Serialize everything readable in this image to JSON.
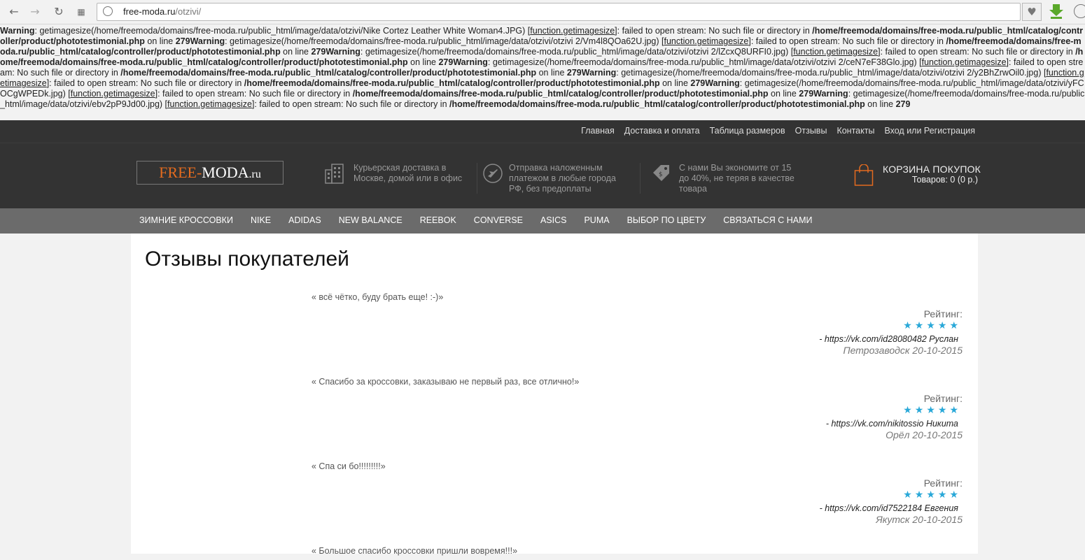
{
  "browser": {
    "url_host": "free-moda.ru",
    "url_path": "/otzivi/"
  },
  "warnings": [
    {
      "bold": "Warning",
      "text": ": getimagesize(/home/freemoda/domains/free-moda.ru/public_html/image/data/otzivi/Nike Cortez Leather White Woman4.JPG) [",
      "func": "function.getimagesize",
      "text2": "]: failed to open stream: No such file or directory in ",
      "path": "/home/freemoda/domains/free-moda.ru/public_html/catalog/controller/product/phototestimonial.php",
      "line_text": " on line ",
      "line": "279"
    },
    {
      "bold": "Warning",
      "text": ": getimagesize(/home/freemoda/domains/free-moda.ru/public_html/image/data/otzivi/otzivi 2/Vm4l8QOa62U.jpg) [",
      "func": "function.getimagesize",
      "text2": "]: failed to open stream: No such file or directory in ",
      "path": "/home/freemoda/domains/free-moda.ru/public_html/catalog/controller/product/phototestimonial.php",
      "line_text": " on line ",
      "line": "279"
    },
    {
      "bold": "Warning",
      "text": ": getimagesize(/home/freemoda/domains/free-moda.ru/public_html/image/data/otzivi/otzivi 2/lZcxQ8URFI0.jpg) [",
      "func": "function.getimagesize",
      "text2": "]: failed to open stream: No such file or directory in ",
      "path": "/home/freemoda/domains/free-moda.ru/public_html/catalog/controller/product/phototestimonial.php",
      "line_text": " on line ",
      "line": "279"
    },
    {
      "bold": "Warning",
      "text": ": getimagesize(/home/freemoda/domains/free-moda.ru/public_html/image/data/otzivi/otzivi 2/ceN7eF38Glo.jpg) [",
      "func": "function.getimagesize",
      "text2": "]: failed to open stream: No such file or directory in ",
      "path": "/home/freemoda/domains/free-moda.ru/public_html/catalog/controller/product/phototestimonial.php",
      "line_text": " on line ",
      "line": "279"
    },
    {
      "bold": "Warning",
      "text": ": getimagesize(/home/freemoda/domains/free-moda.ru/public_html/image/data/otzivi/otzivi 2/y2BhZrwOil0.jpg) [",
      "func": "function.getimagesize",
      "text2": "]: failed to open stream: No such file or directory in ",
      "path": "/home/freemoda/domains/free-moda.ru/public_html/catalog/controller/product/phototestimonial.php",
      "line_text": " on line ",
      "line": "279"
    },
    {
      "bold": "Warning",
      "text": ": getimagesize(/home/freemoda/domains/free-moda.ru/public_html/image/data/otzivi/yFCOCgWPEDk.jpg) [",
      "func": "function.getimagesize",
      "text2": "]: failed to open stream: No such file or directory in ",
      "path": "/home/freemoda/domains/free-moda.ru/public_html/catalog/controller/product/phototestimonial.php",
      "line_text": " on line ",
      "line": "279"
    },
    {
      "bold": "Warning",
      "text": ": getimagesize(/home/freemoda/domains/free-moda.ru/public_html/image/data/otzivi/ebv2pP9Jd00.jpg) [",
      "func": "function.getimagesize",
      "text2": "]: failed to open stream: No such file or directory in ",
      "path": "/home/freemoda/domains/free-moda.ru/public_html/catalog/controller/product/phototestimonial.php",
      "line_text": " on line ",
      "line": "279"
    }
  ],
  "topnav": [
    "Главная",
    "Доставка и оплата",
    "Таблица размеров",
    "Отзывы",
    "Контакты",
    "Вход или Регистрация"
  ],
  "logo": {
    "part1": "FREE-",
    "part2": "MODA",
    "part3": ".ru"
  },
  "features": [
    {
      "icon": "building-icon",
      "text": "Курьерская доставка в Москве, домой или в офис"
    },
    {
      "icon": "plane-icon",
      "text": "Отправка наложенным платежом в любые города РФ, без предоплаты"
    },
    {
      "icon": "price-tag-icon",
      "text": "С нами Вы экономите от 15 до 40%, не теряя в качестве товара"
    }
  ],
  "cart": {
    "title": "КОРЗИНА ПОКУПОК",
    "count": "Товаров: 0 (0 р.)"
  },
  "catnav": [
    "ЗИМНИЕ КРОССОВКИ",
    "NIKE",
    "ADIDAS",
    "NEW BALANCE",
    "REEBOK",
    "CONVERSE",
    "ASICS",
    "PUMA",
    "ВЫБОР ПО ЦВЕТУ",
    "СВЯЗАТЬСЯ С НАМИ"
  ],
  "page_title": "Отзывы покупателей",
  "reviews": [
    {
      "text": "« всё чётко, буду брать еще! :-)»",
      "rating_label": "Рейтинг:",
      "rating": 5,
      "author": "-  https://vk.com/id28080482 Руслан",
      "city_date": "Петрозаводск 20-10-2015"
    },
    {
      "text": "« Спасибо за кроссовки, заказываю не первый раз, все отлично!»",
      "rating_label": "Рейтинг:",
      "rating": 5,
      "author": "-  https://vk.com/nikitossio Никита",
      "city_date": "Орёл 20-10-2015"
    },
    {
      "text": "« Спа си бо!!!!!!!!!»",
      "rating_label": "Рейтинг:",
      "rating": 5,
      "author": "-  https://vk.com/id7522184 Евгения",
      "city_date": "Якутск 20-10-2015"
    },
    {
      "text": "« Большое спасибо кроссовки пришли вовремя!!!»",
      "rating_label": "",
      "rating": 0,
      "author": "",
      "city_date": ""
    }
  ],
  "colors": {
    "accent": "#e36b1f",
    "star": "#29a8d8",
    "header_bg": "#333333",
    "catnav_bg": "#6b6b6b"
  }
}
